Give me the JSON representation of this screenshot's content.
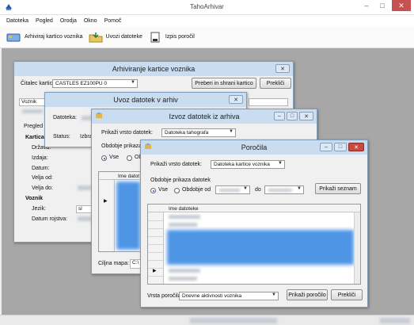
{
  "app": {
    "title": "TahoArhivar",
    "menu": [
      "Datoteka",
      "Pogled",
      "Orodja",
      "Okno",
      "Pomoč"
    ],
    "toolbar": [
      {
        "label": "Arhiviraj kartico voznika",
        "icon": "card-archive-icon"
      },
      {
        "label": "Uvozi datoteke",
        "icon": "folder-import-icon"
      },
      {
        "label": "Izpis poročil",
        "icon": "report-print-icon"
      }
    ],
    "window_controls": {
      "minimize": "–",
      "maximize": "□",
      "close": "✕"
    }
  },
  "win_arhiviranje": {
    "title": "Arhiviranje kartice voznika",
    "reader_label": "Čitalec kartic:",
    "reader_value": "CASTLES EZ100PU 0",
    "read_button": "Preberi in shrani kartico",
    "cancel_button": "Prekliči",
    "voznik_label": "Voznik",
    "pregled_label": "Pregled",
    "kartica_label": "Kartica",
    "drzava_label": "Država:",
    "izdajatelj_label": "Izdaja:",
    "datum_label": "Datum:",
    "velja_od_label": "Velja od:",
    "velja_do_label": "Velja do:",
    "voznik_section": "Voznik",
    "jezik_label": "Jezik:",
    "jezik_value": "sl",
    "datum_rojstva_label": "Datum rojstva:",
    "close": "✕"
  },
  "win_uvoz": {
    "title": "Uvoz datotek v arhiv",
    "datoteka_label": "Datoteka:",
    "status_label": "Status:",
    "status_value": "Izbra",
    "close": "✕"
  },
  "win_izvoz": {
    "title": "Izvoz datotek iz arhiva",
    "type_label": "Prikaži vrsto datotek:",
    "type_value": "Datoteka tahografa",
    "period_label": "Obdobje prikaza d",
    "radio_vse": "Vse",
    "radio_obd": "Obd",
    "col_header": "Ime datot",
    "target_label": "Ciljna mapa:",
    "target_value": "C:\\",
    "buttons": [
      "–",
      "□",
      "✕"
    ]
  },
  "win_porocila": {
    "title": "Poročila",
    "type_label": "Prikaži vrsto datotek:",
    "type_value": "Datoteka kartice voznika",
    "period_label": "Obdobje prikaza datotek",
    "radio_vse": "Vse",
    "radio_obd": "Obdobje od",
    "do_label": "do",
    "list_button": "Prikaži seznam",
    "col_header": "Ime datoteke",
    "report_type_label": "Vrsta poročila:",
    "report_type_value": "Dnevne aktivnosti voznika",
    "show_report_button": "Prikaži poročilo",
    "cancel_button": "Prekliči",
    "buttons": [
      "–",
      "□",
      "✕"
    ]
  }
}
